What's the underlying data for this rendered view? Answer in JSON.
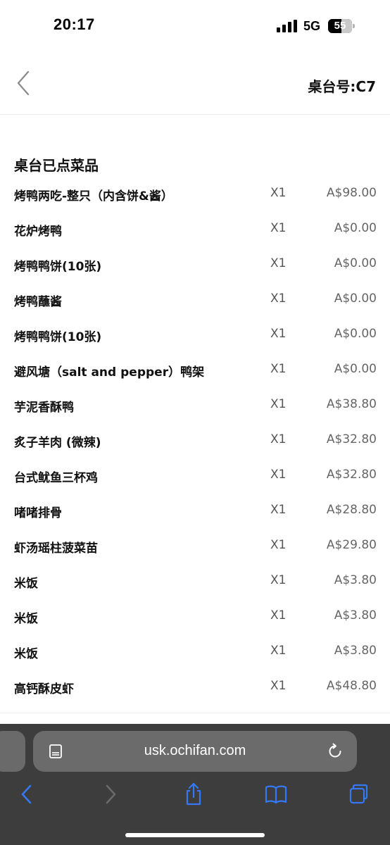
{
  "status": {
    "time": "20:17",
    "network": "5G",
    "battery": "55",
    "battery_percent": 55
  },
  "header": {
    "table_label": "桌台号:C7"
  },
  "section": {
    "title": "桌台已点菜品"
  },
  "orders": [
    {
      "name": "烤鸭两吃-整只（内含饼&酱）",
      "qty": "X1",
      "price": "A$98.00"
    },
    {
      "name": "花炉烤鸭",
      "qty": "X1",
      "price": "A$0.00"
    },
    {
      "name": "烤鸭鸭饼(10张)",
      "qty": "X1",
      "price": "A$0.00"
    },
    {
      "name": "烤鸭蘸酱",
      "qty": "X1",
      "price": "A$0.00"
    },
    {
      "name": "烤鸭鸭饼(10张)",
      "qty": "X1",
      "price": "A$0.00"
    },
    {
      "name": "避风塘（salt and pepper）鸭架",
      "qty": "X1",
      "price": "A$0.00"
    },
    {
      "name": "芋泥香酥鸭",
      "qty": "X1",
      "price": "A$38.80"
    },
    {
      "name": "炙子羊肉 (微辣)",
      "qty": "X1",
      "price": "A$32.80"
    },
    {
      "name": "台式鱿鱼三杯鸡",
      "qty": "X1",
      "price": "A$32.80"
    },
    {
      "name": "啫啫排骨",
      "qty": "X1",
      "price": "A$28.80"
    },
    {
      "name": "虾汤瑶柱菠菜苗",
      "qty": "X1",
      "price": "A$29.80"
    },
    {
      "name": "米饭",
      "qty": "X1",
      "price": "A$3.80"
    },
    {
      "name": "米饭",
      "qty": "X1",
      "price": "A$3.80"
    },
    {
      "name": "米饭",
      "qty": "X1",
      "price": "A$3.80"
    },
    {
      "name": "高钙酥皮虾",
      "qty": "X1",
      "price": "A$48.80"
    }
  ],
  "browser": {
    "url": "usk.ochifan.com"
  },
  "icons": {
    "back": "chevron-left-icon",
    "reader": "reader-mode-icon",
    "reload": "reload-icon",
    "nav_back": "chevron-left-icon",
    "nav_forward": "chevron-right-icon",
    "share": "share-icon",
    "bookmarks": "book-icon",
    "tabs": "tabs-icon"
  },
  "colors": {
    "safari_blue": "#3478f6",
    "browser_bar": "#3d3d3d"
  }
}
